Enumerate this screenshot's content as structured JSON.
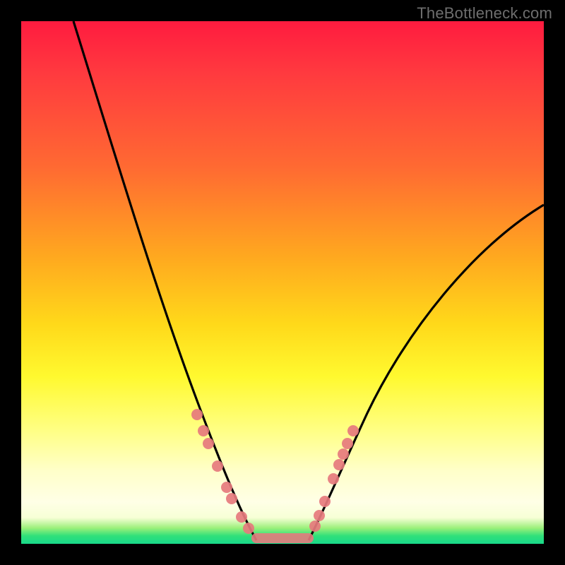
{
  "watermark": "TheBottleneck.com",
  "colors": {
    "dot": "#e67a7d",
    "curve": "#000000"
  },
  "chart_data": {
    "type": "line",
    "title": "",
    "xlabel": "",
    "ylabel": "",
    "xlim": [
      0,
      100
    ],
    "ylim": [
      0,
      100
    ],
    "series": [
      {
        "name": "left-branch",
        "x": [
          10,
          15,
          20,
          25,
          30,
          33,
          35,
          37,
          39,
          41,
          43,
          45
        ],
        "y": [
          100,
          82,
          64,
          46,
          30,
          22,
          17,
          13,
          9,
          6,
          3,
          0
        ]
      },
      {
        "name": "right-branch",
        "x": [
          55,
          57,
          59,
          62,
          66,
          72,
          80,
          90,
          100
        ],
        "y": [
          0,
          4,
          9,
          15,
          22,
          32,
          44,
          56,
          65
        ]
      },
      {
        "name": "floor",
        "x": [
          45,
          55
        ],
        "y": [
          0,
          0
        ]
      }
    ],
    "markers": {
      "left_dots": [
        {
          "x": 33,
          "y": 22
        },
        {
          "x": 35,
          "y": 18
        },
        {
          "x": 36,
          "y": 16
        },
        {
          "x": 38,
          "y": 12
        },
        {
          "x": 40,
          "y": 9
        },
        {
          "x": 41,
          "y": 7
        },
        {
          "x": 43,
          "y": 4
        },
        {
          "x": 44,
          "y": 2
        }
      ],
      "right_dots": [
        {
          "x": 56,
          "y": 3
        },
        {
          "x": 57,
          "y": 5
        },
        {
          "x": 58,
          "y": 8
        },
        {
          "x": 60,
          "y": 13
        },
        {
          "x": 61,
          "y": 16
        },
        {
          "x": 62,
          "y": 18
        },
        {
          "x": 63,
          "y": 20
        },
        {
          "x": 64,
          "y": 22
        }
      ],
      "bottom_bar": {
        "x0": 45,
        "x1": 55,
        "y": 0
      }
    }
  }
}
